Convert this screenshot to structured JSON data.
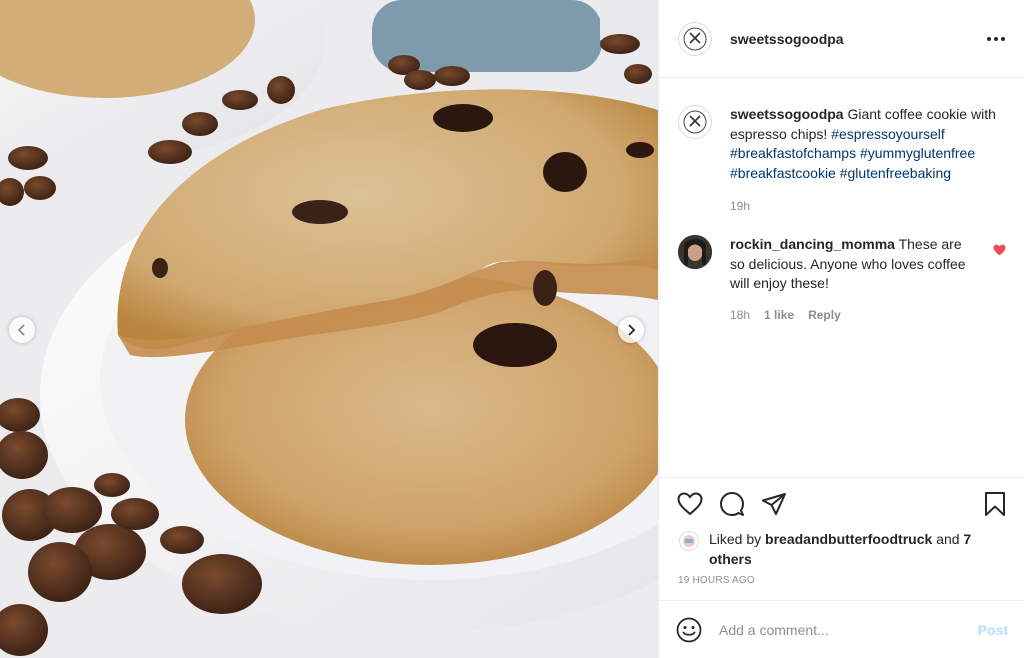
{
  "header": {
    "username": "sweetssogoodpa"
  },
  "caption": {
    "username": "sweetssogoodpa",
    "text": "Giant coffee cookie with espresso chips!",
    "hashtags": [
      "#espressoyourself",
      "#breakfastofchamps",
      "#yummyglutenfree",
      "#breakfastcookie",
      "#glutenfreebaking"
    ],
    "time": "19h"
  },
  "comment": {
    "username": "rockin_dancing_momma",
    "text": "These are so delicious. Anyone who loves coffee will enjoy these!",
    "time": "18h",
    "likes": "1 like",
    "reply": "Reply"
  },
  "likes": {
    "prefix": "Liked by",
    "user": "breadandbutterfoodtruck",
    "and": "and",
    "others": "7 others"
  },
  "post_age": "19 HOURS AGO",
  "add_comment": {
    "placeholder": "Add a comment...",
    "post_label": "Post"
  },
  "icons": [
    "chevron-left-icon",
    "chevron-right-icon",
    "more-icon",
    "heart-icon",
    "comment-icon",
    "share-icon",
    "bookmark-icon",
    "emoji-icon"
  ],
  "colors": {
    "hashtag": "#00376b",
    "like_red": "#ed4956",
    "post_disabled": "#b2dffc",
    "muted": "#8e8e8e"
  }
}
